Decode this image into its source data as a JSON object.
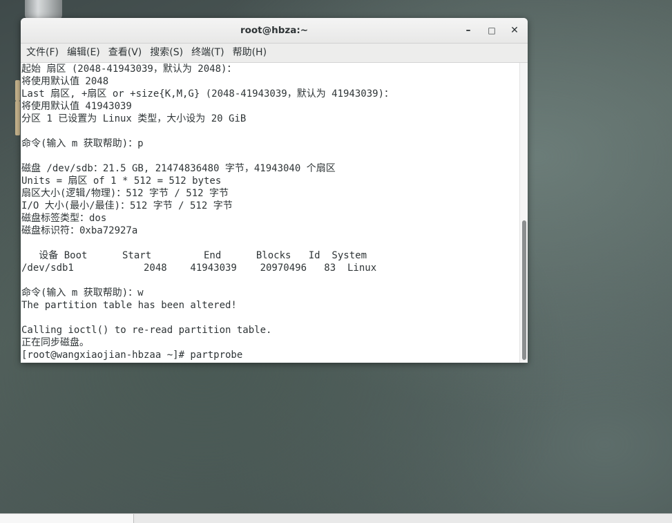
{
  "window": {
    "title": "root@hbza:~",
    "minimize_glyph": "–",
    "maximize_glyph": "□",
    "close_glyph": "✕"
  },
  "menubar": {
    "items": [
      {
        "label": "文件(F)"
      },
      {
        "label": "编辑(E)"
      },
      {
        "label": "查看(V)"
      },
      {
        "label": "搜索(S)"
      },
      {
        "label": "终端(T)"
      },
      {
        "label": "帮助(H)"
      }
    ]
  },
  "terminal": {
    "lines": [
      "起始 扇区 (2048-41943039，默认为 2048)：",
      "将使用默认值 2048",
      "Last 扇区, +扇区 or +size{K,M,G} (2048-41943039，默认为 41943039)：",
      "将使用默认值 41943039",
      "分区 1 已设置为 Linux 类型，大小设为 20 GiB",
      "",
      "命令(输入 m 获取帮助)：p",
      "",
      "磁盘 /dev/sdb：21.5 GB, 21474836480 字节，41943040 个扇区",
      "Units = 扇区 of 1 * 512 = 512 bytes",
      "扇区大小(逻辑/物理)：512 字节 / 512 字节",
      "I/O 大小(最小/最佳)：512 字节 / 512 字节",
      "磁盘标签类型：dos",
      "磁盘标识符：0xba72927a",
      "",
      "   设备 Boot      Start         End      Blocks   Id  System",
      "/dev/sdb1            2048    41943039    20970496   83  Linux",
      "",
      "命令(输入 m 获取帮助)：w",
      "The partition table has been altered!",
      "",
      "Calling ioctl() to re-read partition table.",
      "正在同步磁盘。",
      "[root@wangxiaojian-hbzaa ~]# partprobe"
    ]
  },
  "scrollbar": {
    "position_fraction": 1.0
  }
}
